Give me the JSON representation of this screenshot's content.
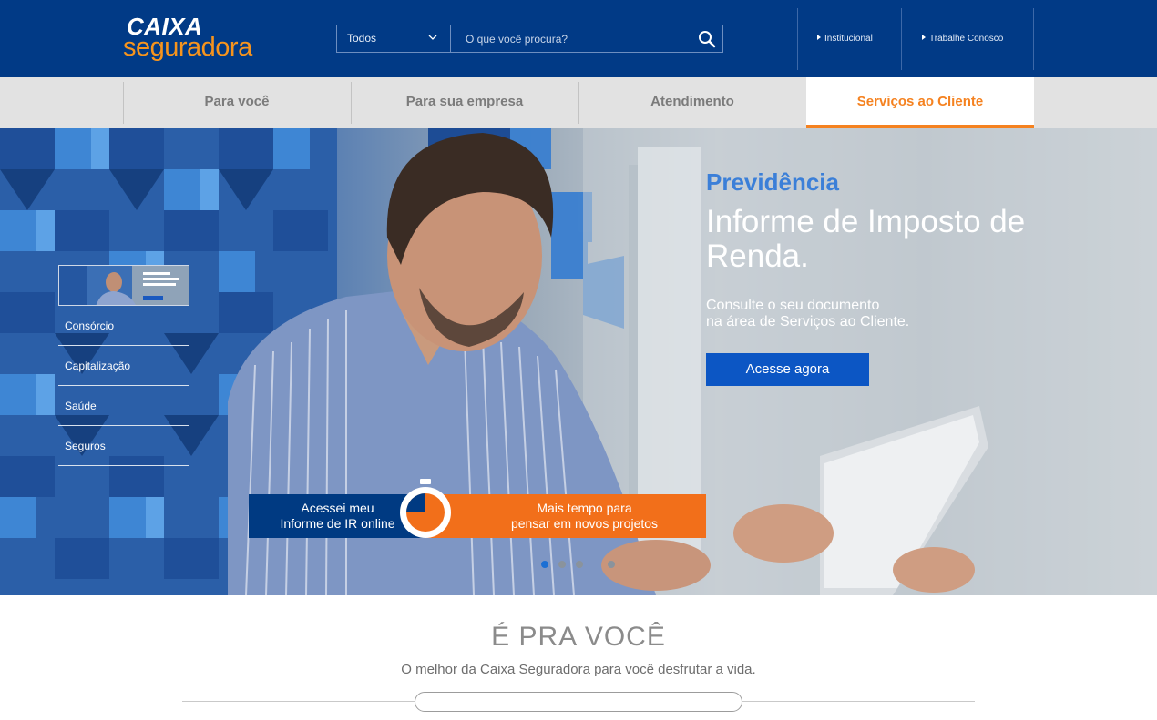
{
  "brand": {
    "line1": "CAIXA",
    "line2": "seguradora",
    "colors": {
      "primary": "#013a86",
      "accent": "#f7941d"
    }
  },
  "search": {
    "category": "Todos",
    "placeholder": "O que você procura?"
  },
  "top_links": [
    {
      "label": "Institucional"
    },
    {
      "label": "Trabalhe Conosco"
    }
  ],
  "nav": {
    "items": [
      {
        "label": "Para você"
      },
      {
        "label": "Para sua empresa"
      },
      {
        "label": "Atendimento"
      },
      {
        "label": "Serviços ao Cliente",
        "active": true
      }
    ]
  },
  "side_menu": {
    "items": [
      {
        "label": "Consórcio"
      },
      {
        "label": "Capitalização"
      },
      {
        "label": "Saúde"
      },
      {
        "label": "Seguros"
      }
    ]
  },
  "hero": {
    "kicker": "Previdência",
    "title": "Informe de Imposto de Renda.",
    "subtitle_line1": "Consulte o seu documento",
    "subtitle_line2": "na área de Serviços ao Cliente.",
    "cta": "Acesse agora",
    "banner_left_line1": "Acessei meu",
    "banner_left_line2": "Informe de IR online",
    "banner_right_line1": "Mais tempo para",
    "banner_right_line2": "pensar em novos projetos",
    "slides_count": 4,
    "active_slide": 1
  },
  "section": {
    "title": "É PRA VOCÊ",
    "subtitle": "O melhor da Caixa Seguradora para você desfrutar a vida."
  }
}
